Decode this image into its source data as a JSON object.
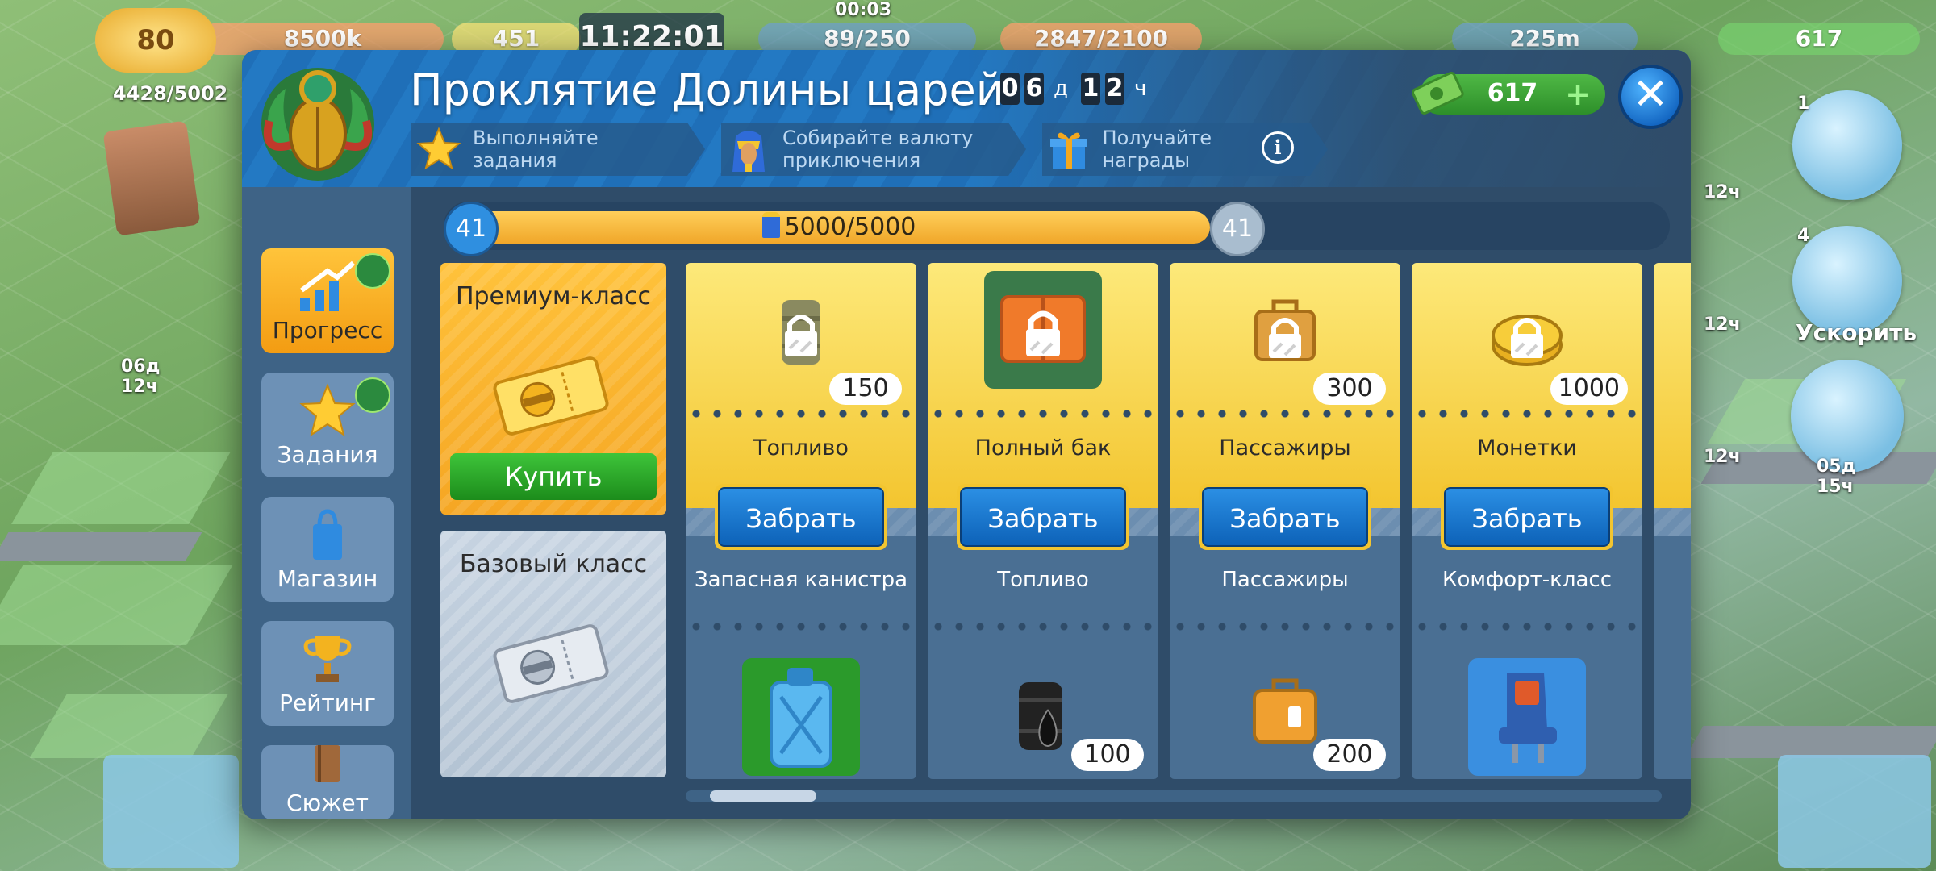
{
  "hud": {
    "level": "80",
    "money": "8500k",
    "stars": "451",
    "clock": "11:22:01",
    "fuel_timer": "00:03",
    "fuel": "89/250",
    "passengers_cap": "2847/2100",
    "coins": "225m",
    "cash": "617",
    "population": "4428/5002",
    "left_event_timer": "06д 12ч",
    "right_badge_1": "1",
    "right_badge_4": "4",
    "speed_up_label": "Ускорить",
    "timer_a": "12ч",
    "timer_b": "12ч",
    "timer_c": "12ч",
    "timer_d": "05д 15ч"
  },
  "modal": {
    "title": "Проклятие Долины царей",
    "timer": {
      "days_digits": [
        "0",
        "6"
      ],
      "days_unit": "д",
      "hours_digits": [
        "1",
        "2"
      ],
      "hours_unit": "ч"
    },
    "steps": [
      {
        "icon": "star-icon",
        "label": "Выполняйте\nзадания"
      },
      {
        "icon": "pharaoh-icon",
        "label": "Собирайте валюту\nприключения"
      },
      {
        "icon": "gift-icon",
        "label": "Получайте награды"
      }
    ],
    "currency_value": "617",
    "close_label": "✕"
  },
  "sidebar": {
    "tabs": [
      {
        "label": "Прогресс",
        "icon": "progress-chart-icon",
        "active": true,
        "badge": true
      },
      {
        "label": "Задания",
        "icon": "star-icon",
        "active": false,
        "badge": true
      },
      {
        "label": "Магазин",
        "icon": "shopping-bag-icon",
        "active": false,
        "badge": false
      },
      {
        "label": "Рейтинг",
        "icon": "trophy-icon",
        "active": false,
        "badge": false
      },
      {
        "label": "Сюжет",
        "icon": "book-icon",
        "active": false,
        "badge": false
      }
    ]
  },
  "progress": {
    "level_current": "41",
    "level_next": "41",
    "text": "5000/5000",
    "fraction": 1.0
  },
  "classes": {
    "premium_title": "Премиум-класс",
    "buy_label": "Купить",
    "basic_title": "Базовый класс"
  },
  "rewards": [
    {
      "premium_name": "Топливо",
      "premium_count": "150",
      "premium_icon": "fuel-barrel-locked-icon",
      "claim_label": "Забрать",
      "basic_name": "Запасная канистра",
      "basic_count": "",
      "basic_icon": "jerrycan-icon"
    },
    {
      "premium_name": "Полный бак",
      "premium_count": "",
      "premium_icon": "orange-crate-locked-icon",
      "claim_label": "Забрать",
      "basic_name": "Топливо",
      "basic_count": "100",
      "basic_icon": "oil-barrel-icon"
    },
    {
      "premium_name": "Пассажиры",
      "premium_count": "300",
      "premium_icon": "suitcase-locked-icon",
      "claim_label": "Забрать",
      "basic_name": "Пассажиры",
      "basic_count": "200",
      "basic_icon": "suitcase-icon"
    },
    {
      "premium_name": "Монетки",
      "premium_count": "1000",
      "premium_icon": "coins-locked-icon",
      "claim_label": "Забрать",
      "basic_name": "Комфорт-класс",
      "basic_count": "",
      "basic_icon": "airplane-seat-icon"
    }
  ],
  "colors": {
    "accent_blue": "#1f6fb8",
    "premium_gold": "#f5a623",
    "claim_blue": "#0d62b8",
    "buy_green": "#1c8c1b"
  }
}
